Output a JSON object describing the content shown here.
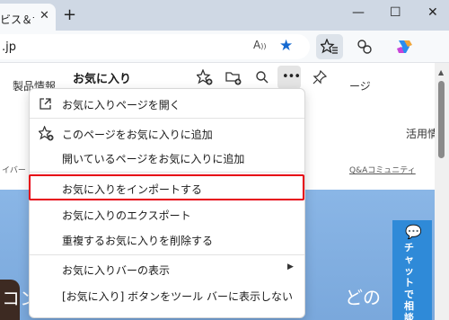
{
  "browser": {
    "tab_title": "ビス＆サ",
    "tab_close_icon": "close-icon",
    "new_tab_icon": "plus-icon",
    "address_text": ".jp",
    "read_aloud_label": "A",
    "toolbar_icons": [
      "read-aloud-icon",
      "star-icon",
      "favorites-icon",
      "extensions-icon",
      "copilot-icon"
    ]
  },
  "page": {
    "nav_left": "製品情報",
    "nav_right": "ージ",
    "usage_right": "活用情",
    "links_left": "イバー",
    "links_right": "Q&Aコミュニティ",
    "hero_left": "コン",
    "hero_right": "どの",
    "chat_label": "チャットで相談"
  },
  "favorites_panel": {
    "title": "お気に入り",
    "icons": [
      "add-favorite-icon",
      "add-folder-icon",
      "search-icon",
      "more-icon",
      "pin-icon"
    ]
  },
  "menu": {
    "items": [
      {
        "label": "お気に入りページを開く",
        "icon": "open-external-icon"
      },
      {
        "label": "このページをお気に入りに追加",
        "icon": "add-favorite-icon"
      },
      {
        "label": "開いているページをお気に入りに追加",
        "icon": ""
      },
      {
        "label": "お気に入りをインポートする",
        "icon": "",
        "highlighted": true
      },
      {
        "label": "お気に入りのエクスポート",
        "icon": ""
      },
      {
        "label": "重複するお気に入りを削除する",
        "icon": ""
      },
      {
        "label": "お気に入りバーの表示",
        "icon": "",
        "submenu": true
      },
      {
        "label": "[お気に入り] ボタンをツール バーに表示しない",
        "icon": ""
      }
    ]
  },
  "colors": {
    "accent": "#1469d1",
    "highlight_border": "#e60012",
    "chat_button": "#2f8ad8",
    "hero_bg": "#8ab6e6"
  }
}
